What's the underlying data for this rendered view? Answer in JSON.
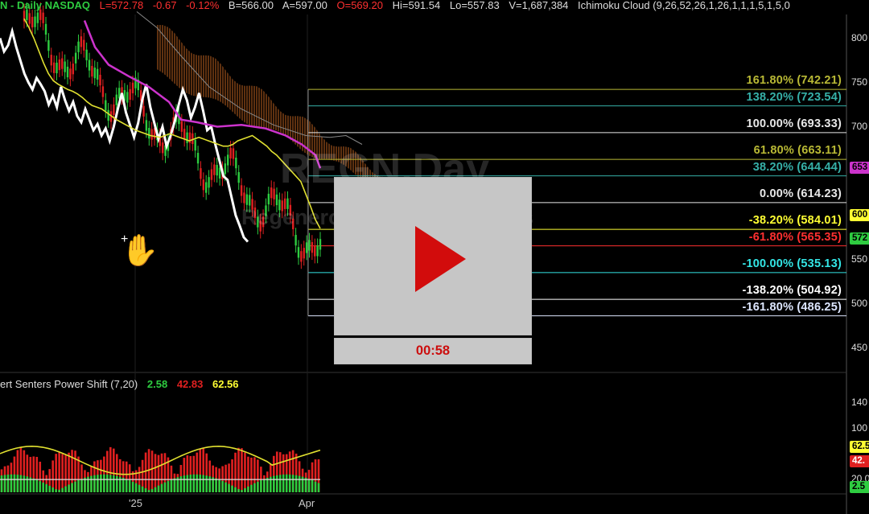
{
  "header": {
    "symbol_exchange": "N - Daily  NASDAQ",
    "last": "L=572.78",
    "change": "-0.67",
    "change_pct": "-0.12%",
    "bid": "B=566.00",
    "ask": "A=597.00",
    "open": "O=569.20",
    "high": "Hi=591.54",
    "low": "Lo=557.83",
    "volume": "V=1,687,384",
    "study": "Ichimoku Cloud (9,26,52,26,1,26,1,1,1,5,1,5,0"
  },
  "watermark": {
    "symbol": "REGN,Day",
    "name": "Regeneron Pharmaceuticals"
  },
  "indicator": {
    "name": "ert Senters Power Shift (7,20)",
    "v1": "2.58",
    "v2": "42.83",
    "v3": "62.56"
  },
  "video": {
    "time": "00:58"
  },
  "colors": {
    "up": "#2ecc40",
    "down": "#e02020",
    "kijun": "#cc33cc",
    "tenkan": "#e0e030",
    "price_line": "#ffffff"
  },
  "chart_data": {
    "type": "line",
    "price_axis_ticks": [
      "800",
      "750",
      "700",
      "650",
      "600",
      "550",
      "500",
      "450"
    ],
    "price_axis_values": [
      800,
      750,
      700,
      650,
      600,
      550,
      500,
      450
    ],
    "ylim": [
      425,
      825
    ],
    "x_ticks": [
      "'25",
      "Apr"
    ],
    "fib_levels": [
      {
        "label": "161.80% (742.21)",
        "price": 742.21,
        "color": "#b9b935"
      },
      {
        "label": "138.20% (723.54)",
        "price": 723.54,
        "color": "#36b0a8"
      },
      {
        "label": "100.00% (693.33)",
        "price": 693.33,
        "color": "#e8e8e8"
      },
      {
        "label": "61.80% (663.11)",
        "price": 663.11,
        "color": "#b9b935"
      },
      {
        "label": "38.20% (644.44)",
        "price": 644.44,
        "color": "#36b0a8"
      },
      {
        "label": "0.00% (614.23)",
        "price": 614.23,
        "color": "#e8e8e8"
      },
      {
        "label": "-38.20% (584.01)",
        "price": 584.01,
        "color": "#ffff33"
      },
      {
        "label": "-61.80% (565.35)",
        "price": 565.35,
        "color": "#ff3030"
      },
      {
        "label": "-100.00% (535.13)",
        "price": 535.13,
        "color": "#33e6e6"
      },
      {
        "label": "-138.20% (504.92)",
        "price": 504.92,
        "color": "#ffffff"
      },
      {
        "label": "-161.80% (486.25)",
        "price": 486.25,
        "color": "#dde6ff"
      }
    ],
    "badges": [
      {
        "label": "653",
        "price": 653,
        "color": "#cc33cc"
      },
      {
        "label": "600",
        "price": 600,
        "color": "#ffff33"
      },
      {
        "label": "572",
        "price": 572.78,
        "color": "#2ecc40"
      }
    ],
    "indicator_axis_ticks": [
      "140",
      "100",
      "20.0"
    ],
    "indicator_axis_values": [
      140,
      100,
      20
    ],
    "indicator_ylim": [
      0,
      160
    ],
    "indicator_badges": [
      {
        "label": "62.5",
        "value": 62.56,
        "color": "#ffff33"
      },
      {
        "label": "42.",
        "value": 42.83,
        "color": "#e02020"
      },
      {
        "label": "2.5",
        "value": 2.58,
        "color": "#2ecc40"
      }
    ],
    "white_line": [
      800,
      785,
      792,
      808,
      790,
      775,
      760,
      750,
      742,
      755,
      748,
      740,
      725,
      735,
      722,
      745,
      730,
      718,
      728,
      712,
      705,
      720,
      708,
      696,
      703,
      690,
      698,
      684,
      700,
      720,
      738,
      716,
      702,
      688,
      704,
      730,
      748,
      722,
      704,
      686,
      700,
      678,
      690,
      706,
      725,
      742,
      730,
      710,
      722,
      738,
      718,
      696,
      700,
      680,
      662,
      644,
      640,
      620,
      600,
      588,
      575,
      570
    ],
    "tenkan": [
      822,
      812,
      800,
      786,
      772,
      760,
      752,
      748,
      745,
      742,
      740,
      737,
      733,
      728,
      724,
      722,
      720,
      716,
      712,
      708,
      705,
      702,
      699,
      696,
      694,
      692,
      690,
      689,
      688,
      690,
      692,
      690,
      688,
      686,
      684,
      686,
      688,
      686,
      684,
      682,
      680,
      678,
      678,
      680,
      684,
      686,
      688,
      690,
      686,
      682,
      678,
      672,
      668,
      662,
      656,
      650,
      644,
      638,
      624,
      610,
      595,
      585
    ]
  }
}
